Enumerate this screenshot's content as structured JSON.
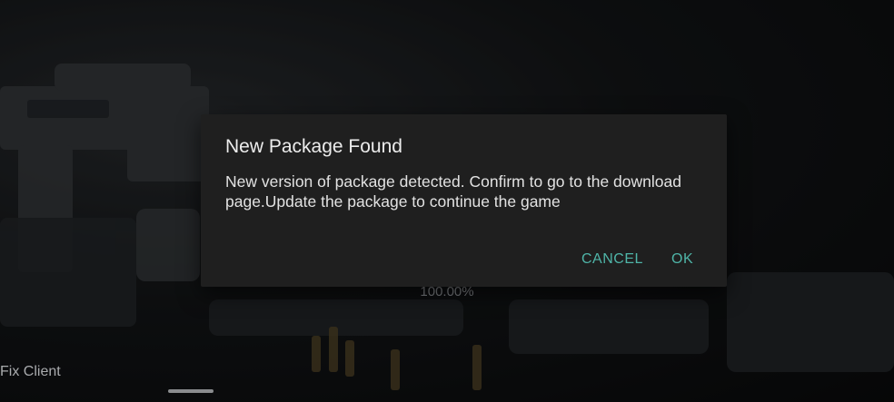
{
  "background": {
    "progress_text": "100.00%",
    "fix_client_label": "Fix Client"
  },
  "dialog": {
    "title": "New Package Found",
    "message": "New version of package detected. Confirm to go to the download page.Update the package to continue the game",
    "cancel_label": "CANCEL",
    "ok_label": "OK"
  },
  "colors": {
    "dialog_background": "#1f1f1f",
    "accent": "#4fb5a8",
    "title_text": "#ececec"
  }
}
